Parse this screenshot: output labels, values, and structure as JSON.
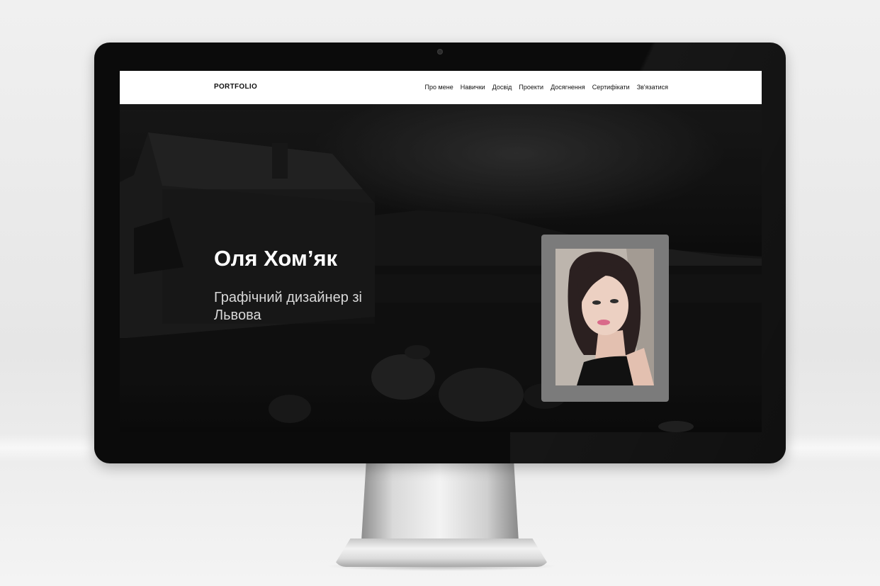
{
  "navbar": {
    "logo": "PORTFOLIO",
    "links": [
      {
        "label": "Про мене"
      },
      {
        "label": "Навички"
      },
      {
        "label": "Досвід"
      },
      {
        "label": "Проекти"
      },
      {
        "label": "Досягнення"
      },
      {
        "label": "Сертифікати"
      },
      {
        "label": "Зв'язатися"
      }
    ]
  },
  "hero": {
    "name": "Оля Хом’як",
    "subtitle": "Графічний дизайнер зі Львова"
  },
  "colors": {
    "navbar_bg": "#ffffff",
    "hero_text": "#ffffff",
    "photo_frame": "#7b7b7b"
  }
}
